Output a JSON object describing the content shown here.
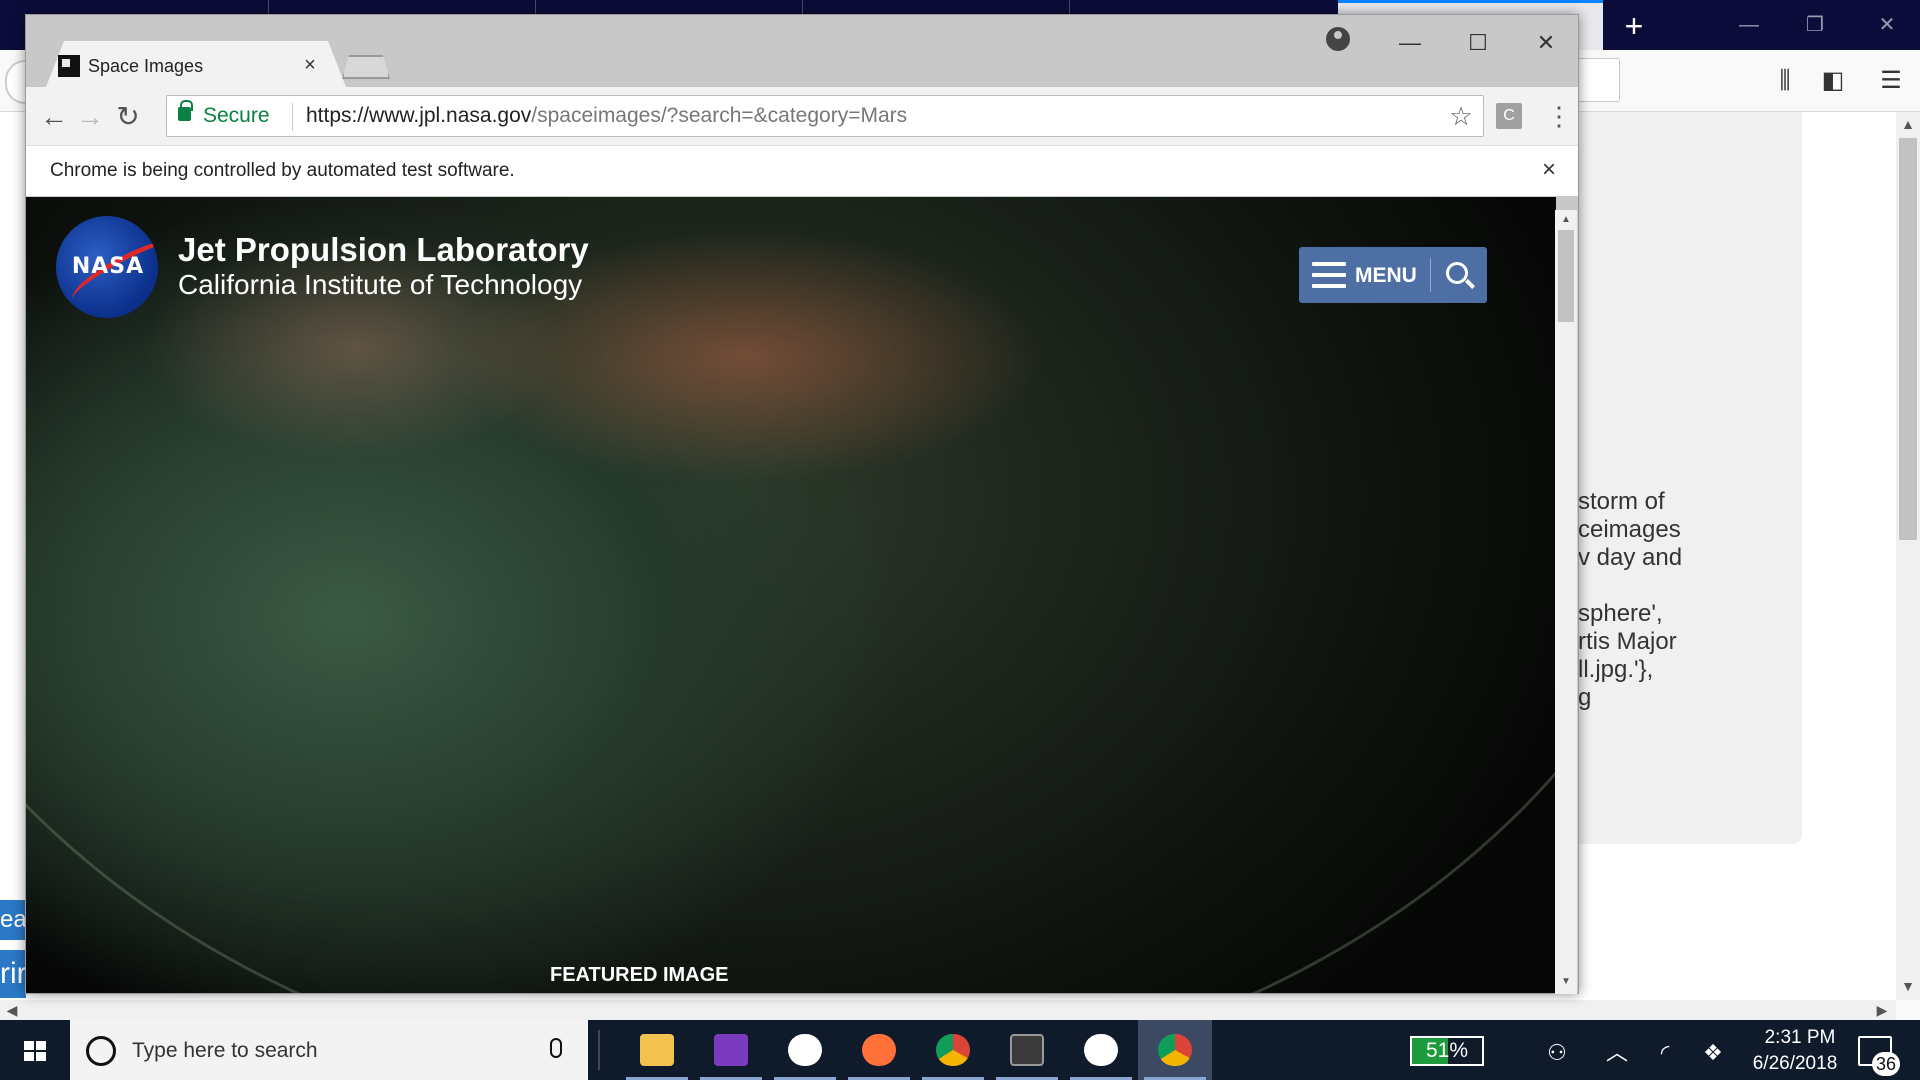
{
  "colors": {
    "firefox_tabbar": "#0c0c3b",
    "chrome_frame": "#c8c8c8",
    "secure_green": "#0b8043",
    "menu_button": "#4e6fa3",
    "taskbar": "#0f1a2b",
    "battery_green": "#1d9a3b"
  },
  "background_window": {
    "text_lines": [
      "storm of",
      "ceimages",
      "v day and",
      "",
      "sphere',",
      "rtis Major",
      "ll.jpg.'},",
      "g"
    ],
    "left_edge_1": "ead",
    "left_edge_2": "rir"
  },
  "chrome": {
    "tab_title": "Space Images",
    "tab_close": "×",
    "omnibox": {
      "secure_label": "Secure",
      "url_host": "https://www.jpl.nasa.gov",
      "url_path": "/spaceimages/?search=&category=Mars"
    },
    "extension_letter": "C",
    "infobar_text": "Chrome is being controlled by automated test software.",
    "infobar_close": "×"
  },
  "page": {
    "logo_text": "NASA",
    "title": "Jet Propulsion Laboratory",
    "subtitle": "California Institute of Technology",
    "menu_label": "MENU",
    "featured_label": "FEATURED IMAGE"
  },
  "taskbar": {
    "search_placeholder": "Type here to search",
    "apps": [
      {
        "name": "file-explorer-icon",
        "color": "#f2c14e"
      },
      {
        "name": "onenote-icon",
        "color": "#7b3bbf"
      },
      {
        "name": "slack-icon",
        "color": "#ffffff"
      },
      {
        "name": "firefox-icon",
        "color": "#ff7139"
      },
      {
        "name": "chrome-icon",
        "color": "#4285f4"
      },
      {
        "name": "terminal-icon",
        "color": "#3a3a3a"
      },
      {
        "name": "mongodb-icon",
        "color": "#4fa94d"
      },
      {
        "name": "chrome-active-icon",
        "color": "#4285f4"
      }
    ],
    "battery_percent": "51%",
    "battery_level": 0.51,
    "clock_time": "2:31 PM",
    "clock_date": "6/26/2018",
    "notification_count": "36"
  }
}
